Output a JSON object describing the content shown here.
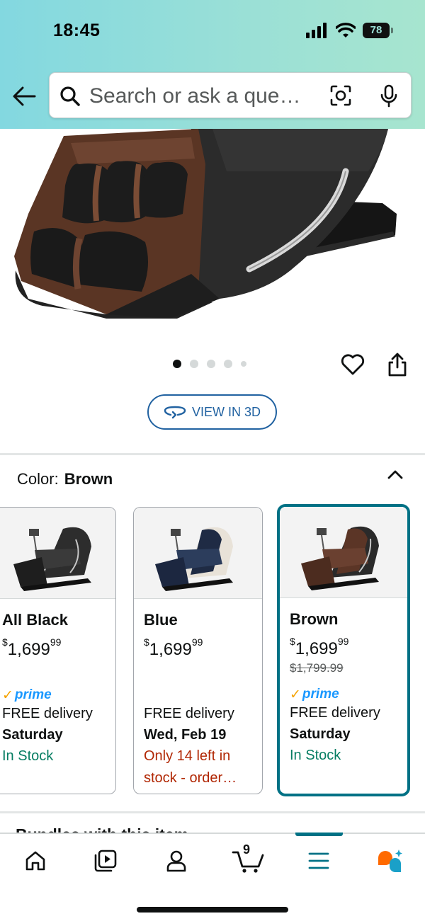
{
  "status_bar": {
    "time": "18:45",
    "battery": "78"
  },
  "search": {
    "placeholder": "Search or ask a que…"
  },
  "carousel": {
    "total_images": 5,
    "active_index": 0
  },
  "view_3d": {
    "label": "VIEW IN 3D"
  },
  "color": {
    "label": "Color:",
    "value": "Brown"
  },
  "swatches": [
    {
      "name": "All Black",
      "currency": "$",
      "price_whole": "1,699",
      "price_fraction": "99",
      "was_price": "",
      "prime": true,
      "prime_label": "prime",
      "delivery_line": "FREE delivery",
      "delivery_date": "Saturday",
      "stock": "In Stock"
    },
    {
      "name": "Blue",
      "currency": "$",
      "price_whole": "1,699",
      "price_fraction": "99",
      "was_price": "",
      "prime": false,
      "prime_label": "",
      "delivery_line": "FREE delivery",
      "delivery_date": "Wed, Feb 19",
      "stock": "Only 14 left in stock - order…"
    },
    {
      "name": "Brown",
      "currency": "$",
      "price_whole": "1,699",
      "price_fraction": "99",
      "was_price": "$1,799.99",
      "prime": true,
      "prime_label": "prime",
      "delivery_line": "FREE delivery",
      "delivery_date": "Saturday",
      "stock": "In Stock"
    }
  ],
  "peek_section": {
    "title": "Bundles with this item"
  },
  "bottom_nav": {
    "cart_count": "9",
    "active_tab": "menu",
    "items": [
      "home-icon",
      "play-icon",
      "account-icon",
      "cart-icon",
      "menu-icon",
      "rufus-icon"
    ]
  },
  "colors": {
    "teal": "#007185",
    "link_blue": "#2162a1",
    "in_stock_green": "#067d62",
    "low_stock_red": "#b12704",
    "prime_blue": "#1a98ff"
  }
}
